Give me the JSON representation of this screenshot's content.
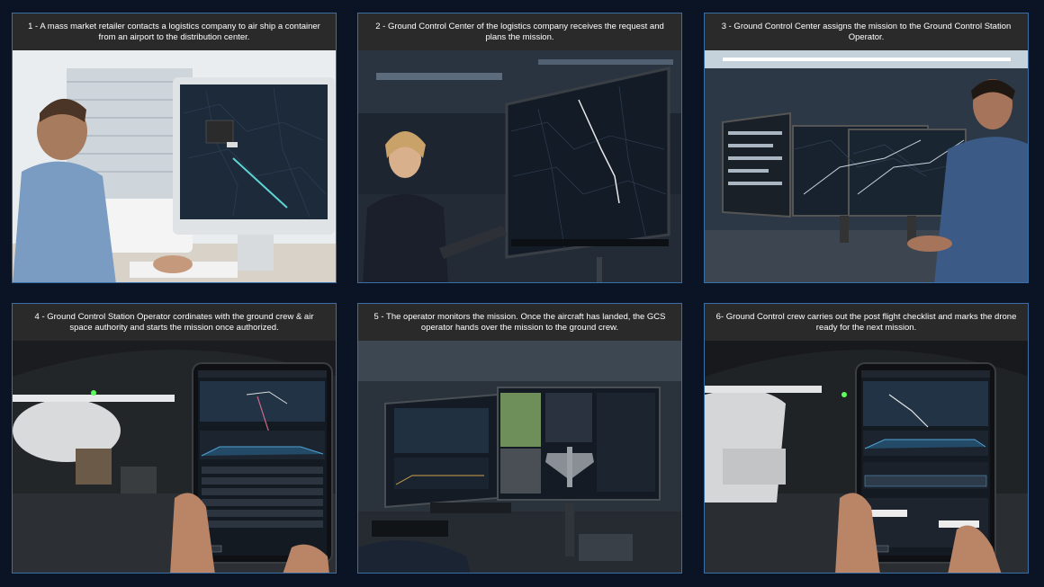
{
  "steps": [
    {
      "caption": "1 - A mass market retailer contacts a logistics company to air ship a container from an airport to the distribution center."
    },
    {
      "caption": "2 - Ground Control Center of the logistics company receives the request and plans the mission."
    },
    {
      "caption": "3 - Ground Control Center assigns the mission to the Ground Control Station Operator."
    },
    {
      "caption": "4 - Ground Control Station Operator cordinates with the ground crew & air space authority and starts the mission once authorized."
    },
    {
      "caption": "5 - The operator monitors the mission. Once the aircraft has landed, the GCS operator hands over the mission to the ground crew."
    },
    {
      "caption": "6- Ground Control crew carries out the post flight checklist and marks the drone ready for the next mission."
    }
  ],
  "colors": {
    "page_background": "#0a1424",
    "panel_border": "#3b6fa8",
    "caption_background": "#2a2a2a",
    "map_route": "#5fd3d3"
  }
}
